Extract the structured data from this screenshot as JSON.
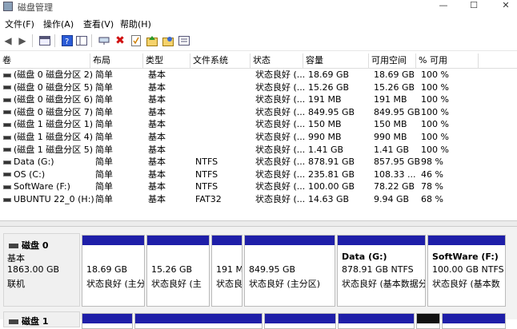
{
  "window": {
    "title": "磁盘管理",
    "min": "—",
    "max": "☐",
    "close": "✕"
  },
  "menu": [
    "文件(F)",
    "操作(A)",
    "查看(V)",
    "帮助(H)"
  ],
  "toolbar_icons": [
    "back-icon",
    "forward-icon",
    "console-icon",
    "help-icon",
    "panel-icon",
    "connect-icon",
    "delete-icon",
    "properties-icon",
    "refresh-icon",
    "export-icon",
    "list-icon"
  ],
  "table": {
    "headers": [
      "卷",
      "布局",
      "类型",
      "文件系统",
      "状态",
      "容量",
      "可用空间",
      "% 可用"
    ],
    "rows": [
      [
        "(磁盘 0 磁盘分区 2)",
        "简单",
        "基本",
        "",
        "状态良好 (...",
        "18.69 GB",
        "18.69 GB",
        "100 %"
      ],
      [
        "(磁盘 0 磁盘分区 5)",
        "简单",
        "基本",
        "",
        "状态良好 (...",
        "15.26 GB",
        "15.26 GB",
        "100 %"
      ],
      [
        "(磁盘 0 磁盘分区 6)",
        "简单",
        "基本",
        "",
        "状态良好 (...",
        "191 MB",
        "191 MB",
        "100 %"
      ],
      [
        "(磁盘 0 磁盘分区 7)",
        "简单",
        "基本",
        "",
        "状态良好 (...",
        "849.95 GB",
        "849.95 GB",
        "100 %"
      ],
      [
        "(磁盘 1 磁盘分区 1)",
        "简单",
        "基本",
        "",
        "状态良好 (...",
        "150 MB",
        "150 MB",
        "100 %"
      ],
      [
        "(磁盘 1 磁盘分区 4)",
        "简单",
        "基本",
        "",
        "状态良好 (...",
        "990 MB",
        "990 MB",
        "100 %"
      ],
      [
        "(磁盘 1 磁盘分区 5)",
        "简单",
        "基本",
        "",
        "状态良好 (...",
        "1.41 GB",
        "1.41 GB",
        "100 %"
      ],
      [
        "Data (G:)",
        "简单",
        "基本",
        "NTFS",
        "状态良好 (...",
        "878.91 GB",
        "857.95 GB",
        "98 %"
      ],
      [
        "OS (C:)",
        "简单",
        "基本",
        "NTFS",
        "状态良好 (...",
        "235.81 GB",
        "108.33 ...",
        "46 %"
      ],
      [
        "SoftWare (F:)",
        "简单",
        "基本",
        "NTFS",
        "状态良好 (...",
        "100.00 GB",
        "78.22 GB",
        "78 %"
      ],
      [
        "UBUNTU 22_0 (H:)",
        "简单",
        "基本",
        "FAT32",
        "状态良好 (...",
        "14.63 GB",
        "9.94 GB",
        "68 %"
      ]
    ]
  },
  "disk0": {
    "name": "磁盘 0",
    "type": "基本",
    "size": "1863.00 GB",
    "status": "联机",
    "partitions": [
      {
        "title": "",
        "size": "18.69 GB",
        "status": "状态良好 (主分"
      },
      {
        "title": "",
        "size": "15.26 GB",
        "status": "状态良好 (主"
      },
      {
        "title": "",
        "size": "191 M",
        "status": "状态良"
      },
      {
        "title": "",
        "size": "849.95 GB",
        "status": "状态良好 (主分区)"
      },
      {
        "title": "Data  (G:)",
        "size": "878.91 GB NTFS",
        "status": "状态良好 (基本数据分"
      },
      {
        "title": "SoftWare  (F:)",
        "size": "100.00 GB NTFS",
        "status": "状态良好 (基本数"
      }
    ]
  },
  "disk1": {
    "name": "磁盘 1"
  },
  "colors": {
    "partition_bar": "#1e1ea8",
    "pane_bg": "#f2f2f2"
  }
}
